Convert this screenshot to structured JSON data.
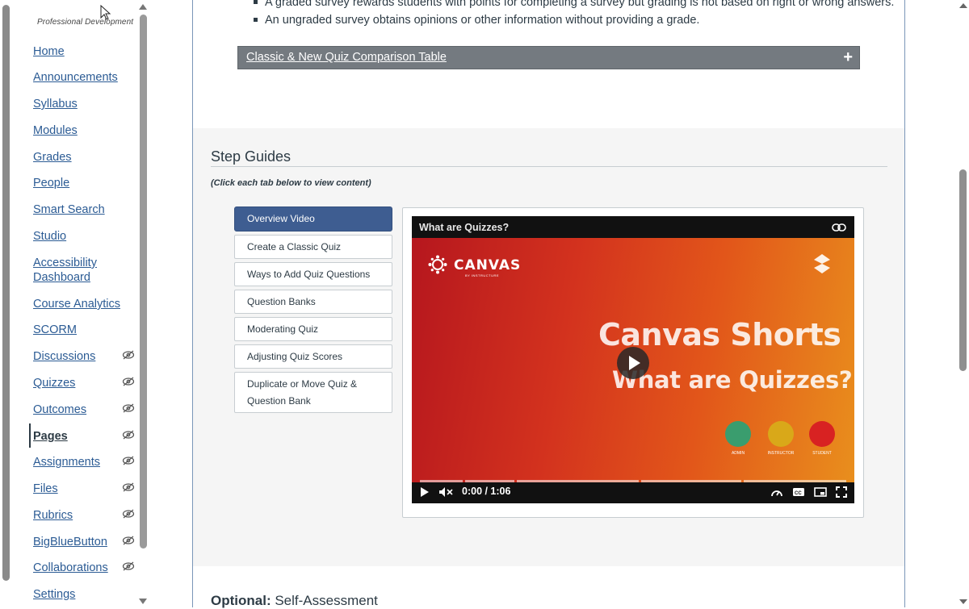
{
  "course": {
    "name": "Professional Development"
  },
  "nav": {
    "items": [
      {
        "label": "Home",
        "hidden": false
      },
      {
        "label": "Announcements",
        "hidden": false
      },
      {
        "label": "Syllabus",
        "hidden": false
      },
      {
        "label": "Modules",
        "hidden": false
      },
      {
        "label": "Grades",
        "hidden": false
      },
      {
        "label": "People",
        "hidden": false
      },
      {
        "label": "Smart Search",
        "hidden": false
      },
      {
        "label": "Studio",
        "hidden": false
      },
      {
        "label": "Accessibility Dashboard",
        "hidden": false
      },
      {
        "label": "Course Analytics",
        "hidden": false
      },
      {
        "label": "SCORM",
        "hidden": false
      },
      {
        "label": "Discussions",
        "hidden": true
      },
      {
        "label": "Quizzes",
        "hidden": true
      },
      {
        "label": "Outcomes",
        "hidden": true
      },
      {
        "label": "Pages",
        "hidden": true,
        "active": true
      },
      {
        "label": "Assignments",
        "hidden": true
      },
      {
        "label": "Files",
        "hidden": true
      },
      {
        "label": "Rubrics",
        "hidden": true
      },
      {
        "label": "BigBlueButton",
        "hidden": true
      },
      {
        "label": "Collaborations",
        "hidden": true
      },
      {
        "label": "Settings",
        "hidden": false
      }
    ],
    "hidden_icon": "eye-slash-icon"
  },
  "content": {
    "bullets": [
      "A graded survey rewards students with points for completing a survey but grading is not based on right or wrong answers.",
      "An ungraded survey obtains opinions or other information without providing a grade."
    ],
    "accordion": {
      "title": "Classic & New Quiz Comparison Table",
      "icon": "plus-icon"
    },
    "step_guides": {
      "title": "Step Guides",
      "hint": "(Click each tab below to view content)",
      "tabs": [
        "Overview Video",
        "Create a Classic Quiz",
        "Ways to Add Quiz Questions",
        "Question Banks",
        "Moderating Quiz",
        "Adjusting Quiz Scores",
        "Duplicate or Move Quiz & Question Bank"
      ],
      "selected_tab": "Overview Video"
    },
    "video": {
      "title": "What are Quizzes?",
      "logo_text": "CANVAS",
      "logo_sub": "BY INSTRUCTURE",
      "headline_1": "Canvas Shorts",
      "headline_2": "What are Quizzes?",
      "roles": [
        "ADMIN",
        "INSTRUCTOR",
        "STUDENT"
      ],
      "time": "0:00 / 1:06",
      "progress": 0
    },
    "optional": {
      "bold": "Optional:",
      "rest": " Self-Assessment"
    }
  },
  "colors": {
    "link": "#2b5b94",
    "selected_tab": "#3e5d91",
    "accordion": "#747a80",
    "section_bg": "#f5f5f5"
  }
}
